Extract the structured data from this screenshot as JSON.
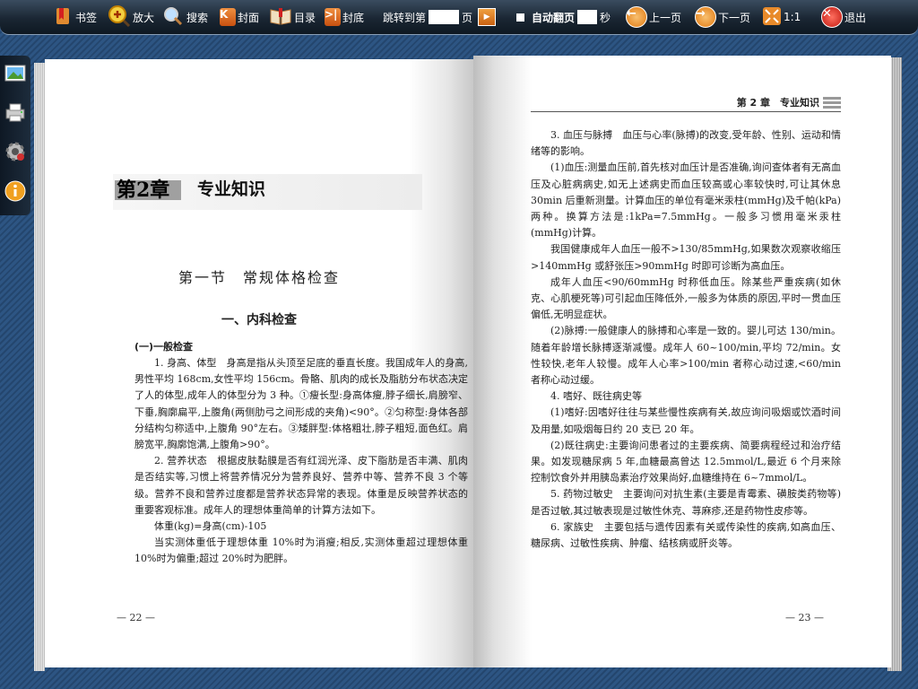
{
  "toolbar": {
    "bookmark": "书签",
    "zoom": "放大",
    "search": "搜索",
    "cover": "封面",
    "contents": "目录",
    "back_cover": "封底",
    "jump_prefix": "跳转到第",
    "jump_suffix": "页",
    "auto_flip_prefix": "自动翻页",
    "auto_flip_suffix": "秒",
    "prev": "上一页",
    "next": "下一页",
    "ratio": "1:1",
    "exit": "退出"
  },
  "side_tools": [
    "image-icon",
    "printer-icon",
    "settings-icon",
    "info-icon"
  ],
  "left_page": {
    "chapter_label": "第2章",
    "chapter_title": "专业知识",
    "section_title": "第一节　常规体格检查",
    "subsection_title": "一、内科检查",
    "subsubsection_title": "(一)一般检查",
    "paragraphs": [
      "1. 身高、体型　身高是指从头顶至足底的垂直长度。我国成年人的身高,男性平均 168cm,女性平均 156cm。骨骼、肌肉的成长及脂肪分布状态决定了人的体型,成年人的体型分为 3 种。①瘦长型:身高体瘦,脖子细长,肩膀窄、下垂,胸廓扁平,上腹角(两侧肋弓之间形成的夹角)<90°。②匀称型:身体各部分结构匀称适中,上腹角 90°左右。③矮胖型:体格粗壮,脖子粗短,面色红。肩膀宽平,胸廓饱满,上腹角>90°。",
      "2. 营养状态　根据皮肤黏膜是否有红润光泽、皮下脂肪是否丰满、肌肉是否结实等,习惯上将营养情况分为营养良好、营养中等、营养不良 3 个等级。营养不良和营养过度都是营养状态异常的表现。体重是反映营养状态的重要客观标准。成年人的理想体重简单的计算方法如下。",
      "体重(kg)=身高(cm)-105",
      "当实测体重低于理想体重 10%时为消瘦;相反,实测体重超过理想体重 10%时为偏重;超过 20%时为肥胖。"
    ],
    "page_number": "— 22 —"
  },
  "right_page": {
    "running_head": "第 2 章　专业知识",
    "paragraphs": [
      "3. 血压与脉搏　血压与心率(脉搏)的改变,受年龄、性别、运动和情绪等的影响。",
      "(1)血压:测量血压前,首先核对血压计是否准确,询问查体者有无高血压及心脏病病史,如无上述病史而血压较高或心率较快时,可让其休息 30min 后重新测量。计算血压的单位有毫米汞柱(mmHg)及千帕(kPa)两种。换算方法是:1kPa=7.5mmHg。一般多习惯用毫米汞柱(mmHg)计算。",
      "我国健康成年人血压一般不>130/85mmHg,如果数次观察收缩压>140mmHg 或舒张压>90mmHg 时即可诊断为高血压。",
      "成年人血压<90/60mmHg 时称低血压。除某些严重疾病(如休克、心肌梗死等)可引起血压降低外,一般多为体质的原因,平时一贯血压偏低,无明显症状。",
      "(2)脉搏:一般健康人的脉搏和心率是一致的。婴儿可达 130/min。随着年龄增长脉搏逐渐减慢。成年人 60~100/min,平均 72/min。女性较快,老年人较慢。成年人心率>100/min 者称心动过速,<60/min 者称心动过缓。",
      "4. 嗜好、既往病史等",
      "(1)嗜好:因嗜好往往与某些慢性疾病有关,故应询问吸烟或饮酒时间及用量,如吸烟每日约 20 支已 20 年。",
      "(2)既往病史:主要询问患者过的主要疾病、简要病程经过和治疗结果。如发现糖尿病 5 年,血糖最高曾达 12.5mmol/L,最近 6 个月来除控制饮食外并用胰岛素治疗效果尚好,血糖维持在 6~7mmol/L。",
      "5. 药物过敏史　主要询问对抗生素(主要是青霉素、磺胺类药物等)是否过敏,其过敏表现是过敏性休克、荨麻疹,还是药物性皮疹等。",
      "6. 家族史　主要包括与遗传因素有关或传染性的疾病,如高血压、糖尿病、过敏性疾病、肿瘤、结核病或肝炎等。"
    ],
    "page_number": "— 23 —"
  }
}
